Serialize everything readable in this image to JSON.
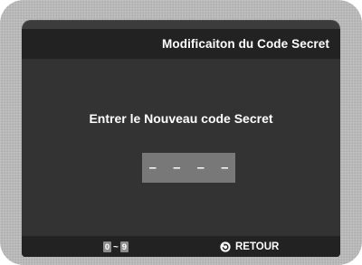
{
  "dialog": {
    "title": "Modificaiton du Code Secret",
    "prompt": "Entrer le Nouveau code Secret",
    "code_placeholder": "– – – –"
  },
  "footer": {
    "range_start": "0",
    "range_separator": "~",
    "range_end": "9",
    "return_icon": "return-arrow-icon",
    "return_label": "RETOUR"
  },
  "colors": {
    "bezel": "#b9b9b9",
    "screen_bg": "#333333",
    "bar_bg": "#222222",
    "code_box": "#787878",
    "key_badge": "#8c8c8c",
    "text": "#ffffff"
  }
}
